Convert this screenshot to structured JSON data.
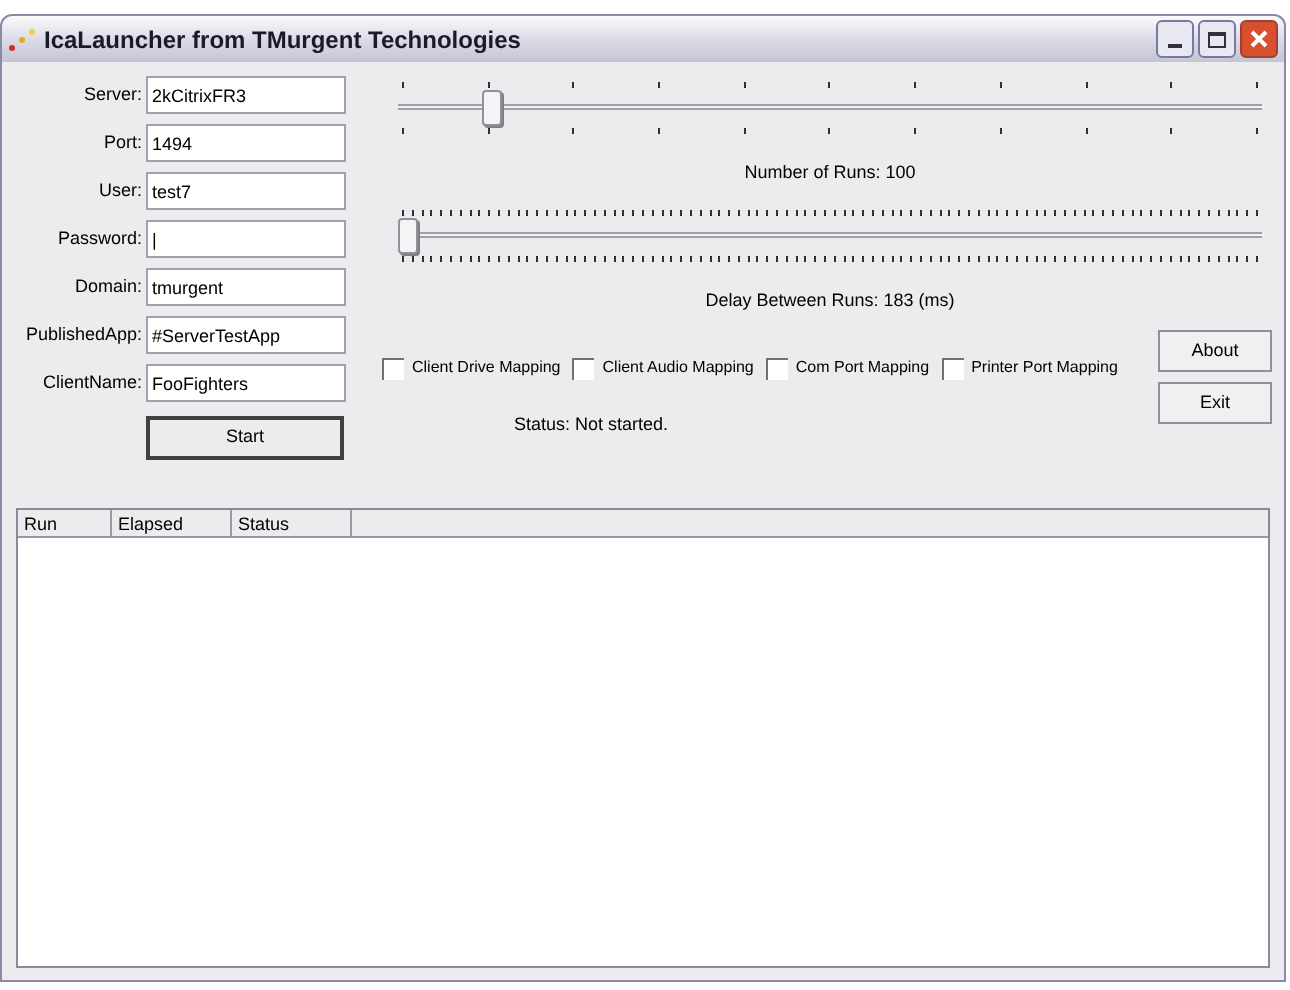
{
  "window": {
    "title": "IcaLauncher from TMurgent Technologies"
  },
  "fields": [
    {
      "label": "Server:",
      "value": "2kCitrixFR3"
    },
    {
      "label": "Port:",
      "value": "1494"
    },
    {
      "label": "User:",
      "value": "test7"
    },
    {
      "label": "Password:",
      "value": "|"
    },
    {
      "label": "Domain:",
      "value": "tmurgent"
    },
    {
      "label": "PublishedApp:",
      "value": "#ServerTestApp"
    },
    {
      "label": "ClientName:",
      "value": "FooFighters"
    }
  ],
  "start_button": "Start",
  "sliders": [
    {
      "level": 0.1,
      "kind": "sparse",
      "caption": "Number of Runs: 100"
    },
    {
      "level": 0,
      "kind": "dense",
      "caption": "Delay Between Runs: 183 (ms)"
    }
  ],
  "checkboxes": [
    {
      "label": "Client Drive Mapping",
      "checked": false
    },
    {
      "label": "Client Audio Mapping",
      "checked": false
    },
    {
      "label": "Com Port Mapping",
      "checked": false
    },
    {
      "label": "Printer Port Mapping",
      "checked": false
    }
  ],
  "buttons": [
    "About",
    "Exit"
  ],
  "status": "Status: Not started.",
  "list": {
    "columns": [
      "Run",
      "Elapsed",
      "Status"
    ]
  }
}
